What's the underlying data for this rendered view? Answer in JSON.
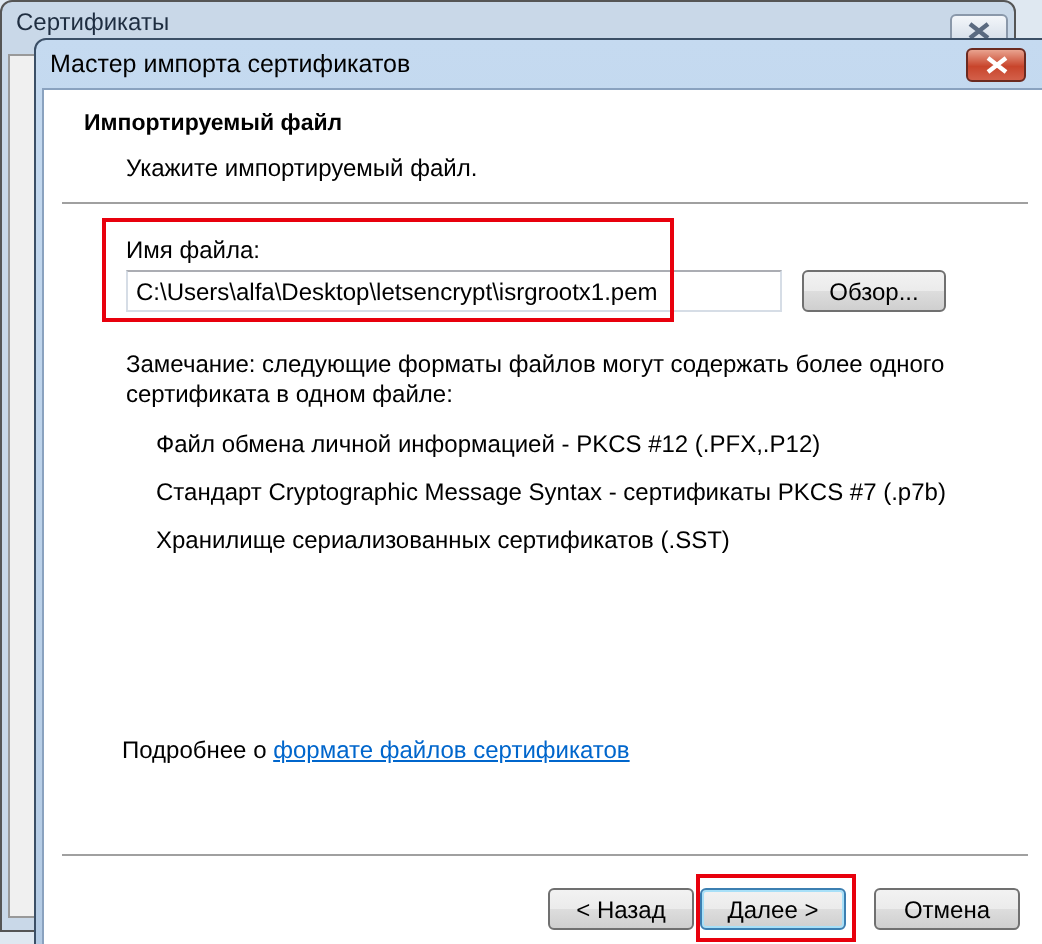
{
  "background_window": {
    "title": "Сертификаты"
  },
  "wizard": {
    "title": "Мастер импорта сертификатов",
    "header": {
      "title": "Импортируемый файл",
      "subtitle": "Укажите импортируемый файл."
    },
    "file_field": {
      "label": "Имя файла:",
      "value": "C:\\Users\\alfa\\Desktop\\letsencrypt\\isrgrootx1.pem",
      "highlighted": true
    },
    "browse_button": "Обзор...",
    "note": "Замечание: следующие форматы файлов могут содержать более одного сертификата в одном файле:",
    "formats": [
      "Файл обмена личной информацией - PKCS #12 (.PFX,.P12)",
      "Стандарт Cryptographic Message Syntax - сертификаты PKCS #7 (.p7b)",
      "Хранилище сериализованных сертификатов (.SST)"
    ],
    "more_info": {
      "text": "Подробнее о",
      "link": "формате файлов сертификатов"
    },
    "buttons": [
      {
        "label": "< Назад",
        "highlighted": false
      },
      {
        "label": "Далее >",
        "highlighted": true
      },
      {
        "label": "Отмена",
        "highlighted": false
      }
    ]
  }
}
